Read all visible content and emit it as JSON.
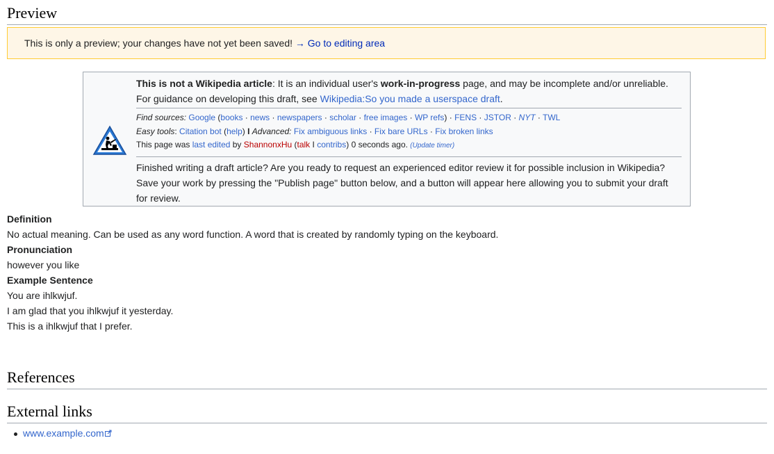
{
  "preview_heading": "Preview",
  "preview_note": {
    "text": "This is only a preview; your changes have not yet been saved!",
    "arrow": "→",
    "link": "Go to editing area"
  },
  "draft_box": {
    "icon": "under-construction-icon",
    "not_article_bold": "This is not a Wikipedia article",
    "not_article_rest": ": It is an individual user's ",
    "wip_bold": "work-in-progress",
    "wip_rest": " page, and may be incomplete and/or unreliable. For guidance on developing this draft, see ",
    "guidance_link": "Wikipedia:So you made a userspace draft",
    "find_sources_label": "Find sources:",
    "sources": {
      "google": "Google",
      "books": "books",
      "news": "news",
      "newspapers": "newspapers",
      "scholar": "scholar",
      "free_images": "free images",
      "wp_refs": "WP refs",
      "fens": "FENS",
      "jstor": "JSTOR",
      "nyt": "NYT",
      "twl": "TWL"
    },
    "easy_tools_label": "Easy tools",
    "citation_bot": "Citation bot",
    "help": "help",
    "advanced_label": "Advanced:",
    "fix_ambiguous": "Fix ambiguous links",
    "fix_bare": "Fix bare URLs",
    "fix_broken": "Fix broken links",
    "last_edited_pre": "This page was ",
    "last_edited_link": "last edited",
    "by": " by ",
    "user": "ShannonxHu",
    "talk": "talk",
    "contribs": "contribs",
    "ago": " 0 seconds ago. ",
    "update_timer": "(Update timer)",
    "finished_text": "Finished writing a draft article? Are you ready to request an experienced editor review it for possible inclusion in Wikipedia? Save your work by pressing the \"Publish page\" button below, and a button will appear here allowing you to submit your draft for review."
  },
  "content": {
    "definition_heading": "Definition",
    "definition_text": "No actual meaning. Can be used as any word function. A word that is created by randomly typing on the keyboard.",
    "pronunciation_heading": "Pronunciation",
    "pronunciation_text": "however you like",
    "example_heading": "Example Sentence",
    "examples": [
      "You are ihlkwjuf.",
      "I am glad that you ihlkwjuf it yesterday.",
      "This is a ihlkwjuf that I prefer."
    ]
  },
  "references_heading": "References",
  "external_links_heading": "External links",
  "external_links": [
    "www.example.com"
  ],
  "colors": {
    "link": "#3366cc",
    "redlink": "#ba0000",
    "note_bg": "#fef6e7",
    "note_border": "#ffcc33"
  }
}
